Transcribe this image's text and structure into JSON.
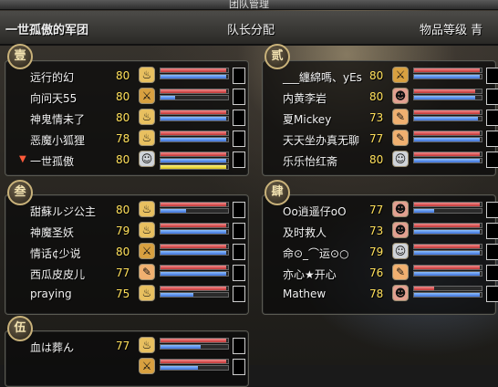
{
  "window": {
    "title": "团队管理"
  },
  "header": {
    "team_name": "一世孤傲的军团",
    "leader_assign": "队长分配",
    "item_grade": "物品等级 青"
  },
  "colors": {
    "hp": "#c23535",
    "mp": "#3c70d9",
    "sp": "#d9c21e",
    "level": "#ffe05a",
    "badge_border": "#c9b27a"
  },
  "groups": [
    {
      "badge": "壹",
      "members": [
        {
          "name": "远行的幻",
          "level": "80",
          "icon": "torch-icon",
          "hp": 0.97,
          "mp": 0.97
        },
        {
          "name": "向问天55",
          "level": "80",
          "icon": "sword-icon",
          "hp": 0.97,
          "mp": 0.22
        },
        {
          "name": "神鬼情未了",
          "level": "80",
          "icon": "torch-icon",
          "hp": 0.97,
          "mp": 0.97
        },
        {
          "name": "恶魔小狐狸",
          "level": "78",
          "icon": "torch-icon",
          "hp": 0.97,
          "mp": 0.97
        },
        {
          "name": "一世孤傲",
          "level": "80",
          "icon": "mask-icon",
          "hp": 0.97,
          "mp": 0.97,
          "sp": 0.97,
          "leader": true
        }
      ]
    },
    {
      "badge": "贰",
      "members": [
        {
          "name": "___纏綿嗎、yEs",
          "level": "80",
          "icon": "sword-icon",
          "hp": 0.97,
          "mp": 0.97
        },
        {
          "name": "内黄李岩",
          "level": "80",
          "icon": "face-icon",
          "hp": 0.9,
          "mp": 0.9
        },
        {
          "name": "夏Mickey",
          "level": "73",
          "icon": "brush-icon",
          "hp": 0.97,
          "mp": 0.95
        },
        {
          "name": "天天坐办真无聊",
          "level": "77",
          "icon": "brush-icon",
          "hp": 0.97,
          "mp": 0.97
        },
        {
          "name": "乐乐怡红斋",
          "level": "80",
          "icon": "mask-icon",
          "hp": 0.97,
          "mp": 0.97
        }
      ]
    },
    {
      "badge": "叁",
      "members": [
        {
          "name": "甜蘇ルジ公主",
          "level": "80",
          "icon": "torch-icon",
          "hp": 0.97,
          "mp": 0.38
        },
        {
          "name": "神魔圣妖",
          "level": "79",
          "icon": "torch-icon",
          "hp": 0.97,
          "mp": 0.97
        },
        {
          "name": "情话¢少说",
          "level": "80",
          "icon": "sword-icon",
          "hp": 0.97,
          "mp": 0.97
        },
        {
          "name": "西瓜皮皮儿",
          "level": "77",
          "icon": "brush-icon",
          "hp": 0.97,
          "mp": 0.97
        },
        {
          "name": "praying",
          "level": "75",
          "icon": "torch-icon",
          "hp": 0.97,
          "mp": 0.48
        }
      ]
    },
    {
      "badge": "肆",
      "members": [
        {
          "name": "Oo逍遥仔oO",
          "level": "77",
          "icon": "face-icon",
          "hp": 0.97,
          "mp": 0.3
        },
        {
          "name": "及时救人",
          "level": "73",
          "icon": "face-icon",
          "hp": 0.97,
          "mp": 0.97
        },
        {
          "name": "命⊙_⌒运⊙○",
          "level": "79",
          "icon": "mask-icon",
          "hp": 0.97,
          "mp": 0.97
        },
        {
          "name": "亦心★开心",
          "level": "76",
          "icon": "brush-icon",
          "hp": 0.97,
          "mp": 0.97
        },
        {
          "name": "Mathew",
          "level": "78",
          "icon": "face-icon",
          "hp": 0.3,
          "mp": 0.97
        }
      ]
    },
    {
      "badge": "伍",
      "members": [
        {
          "name": "血は葬ん",
          "level": "77",
          "icon": "torch-icon",
          "hp": 0.97,
          "mp": 0.6
        },
        {
          "name": "",
          "level": "",
          "icon": "sword-icon",
          "hp": 0.97,
          "mp": 0.55
        }
      ]
    }
  ]
}
